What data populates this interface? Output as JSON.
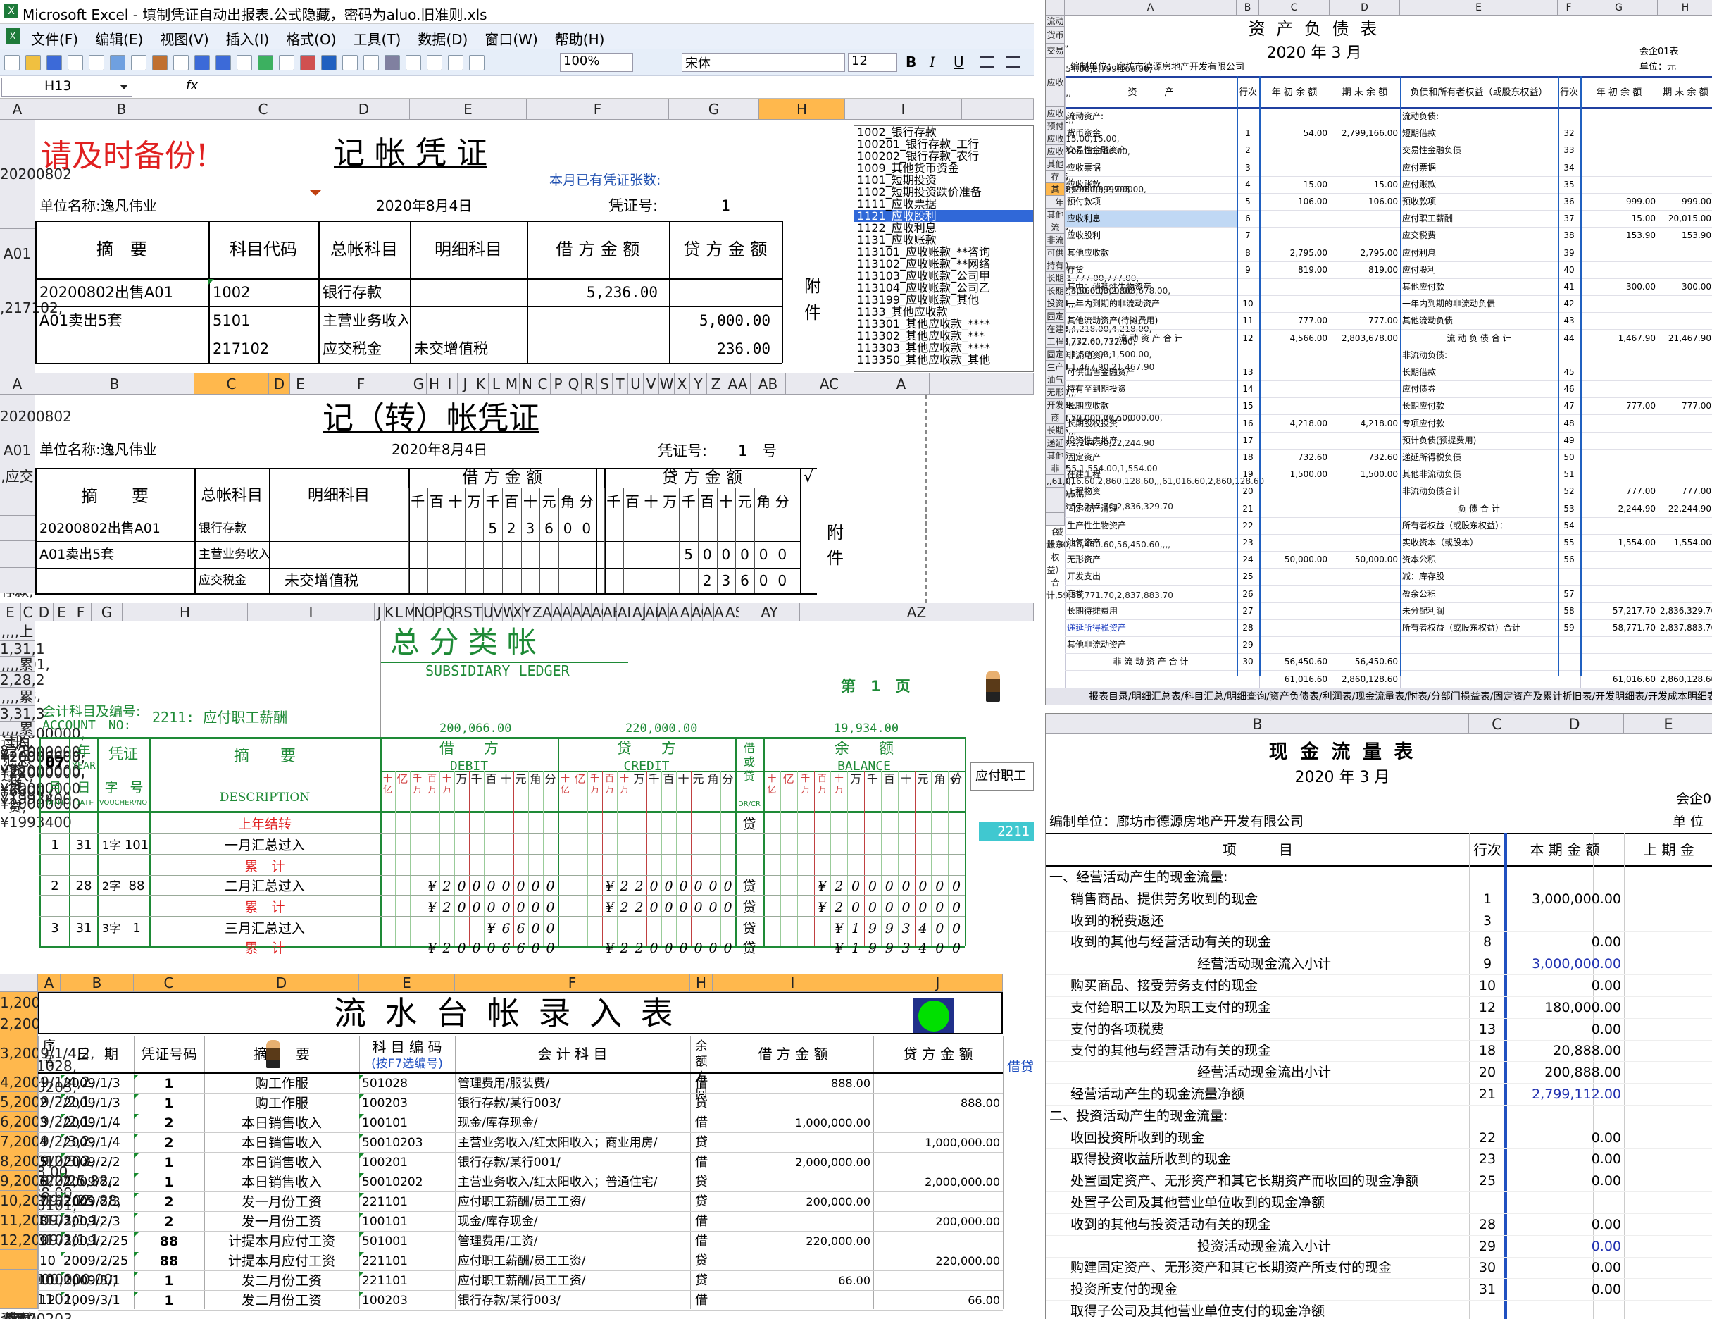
{
  "app": {
    "title": "Microsoft Excel - 填制凭证自动出报表.公式隐藏，密码为aluo.旧准则.xls",
    "name_box": "H13",
    "fx": "fx",
    "zoom": "100%",
    "font": "宋体",
    "size": "12"
  },
  "menu": [
    "文件(F)",
    "编辑(E)",
    "视图(V)",
    "插入(I)",
    "格式(O)",
    "工具(T)",
    "数据(D)",
    "窗口(W)",
    "帮助(H)"
  ],
  "fmt": {
    "bold": "B",
    "italic": "I",
    "under": "U"
  },
  "v1": {
    "cols": [
      "A",
      "B",
      "C",
      "D",
      "E",
      "F",
      "G",
      "H",
      "I"
    ],
    "rows": [
      [
        "20200802出售A01",
        "1002",
        "银行存款",
        "",
        "5,236.00",
        ""
      ],
      [
        "A01卖出5套",
        "5101",
        "主营业务收入",
        "",
        "",
        "5,000.00"
      ],
      [
        "",
        "217102",
        "应交税金",
        "未交增值税",
        "",
        "236.00"
      ]
    ],
    "reminder": "请及时备份!",
    "title": "记 帐 凭 证",
    "count_label": "本月已有凭证张数:",
    "unit": "单位名称:逸凡伟业",
    "date": "2020年8月4日",
    "no_label": "凭证号:",
    "no": "1",
    "headers": [
      "摘　要",
      "科目代码",
      "总帐科目",
      "明细科目",
      "借 方 金 额",
      "贷 方 金 额"
    ],
    "attach": [
      "附",
      "件"
    ],
    "list": [
      "1002_银行存款",
      "100201_银行存款_工行",
      "100202_银行存款_农行",
      "1009_其他货币资金",
      "1101_短期投资",
      "1102_短期投资跌价准备",
      "1111_应收票据",
      "1121_应收股利",
      "1122_应收利息",
      "1131_应收账款",
      "113101_应收账款_**咨询",
      "113102_应收账款_**网络",
      "113103_应收账款_公司甲",
      "113104_应收账款_公司乙",
      "113199_应收账款_其他",
      "1133_其他应收款",
      "113301_其他应收款_****",
      "113302_其他应收款_***",
      "113303_其他应收款_****",
      "113350_其他应收款_其他"
    ]
  },
  "v2": {
    "cols": [
      "A",
      "B",
      "C",
      "D",
      "E",
      "F",
      "G",
      "H",
      "I",
      "J",
      "K",
      "L",
      "M",
      "N",
      "C",
      "P",
      "Q",
      "R",
      "S",
      "T",
      "U",
      "V",
      "W",
      "X",
      "Y",
      "Z",
      "AA",
      "AB",
      "AC",
      "A"
    ],
    "rows": [
      [
        "20200802出售A01",
        "银行存款",
        ""
      ],
      [
        "A01卖出5套",
        "主营业务收入",
        ""
      ],
      [
        "",
        "应交税金",
        "未交增值税"
      ]
    ],
    "title": "记（转）帐凭证",
    "unit": "单位名称:逸凡伟业",
    "date": "2020年8月4日",
    "no_label": "凭证号:",
    "no": "1",
    "no_suffix": "号",
    "headers": [
      "摘　　要",
      "总帐科目",
      "明细科目",
      "借 方 金 额",
      "贷 方 金 额",
      "√"
    ],
    "units": [
      "千",
      "百",
      "十",
      "万",
      "千",
      "百",
      "十",
      "元",
      "角",
      "分"
    ],
    "debit": [
      "5",
      "2",
      "3",
      "6",
      "0",
      "0"
    ],
    "credit1": [
      "5",
      "0",
      "0",
      "0",
      "0",
      "0"
    ],
    "credit2": [
      "2",
      "3",
      "6",
      "0",
      "0"
    ],
    "attach": [
      "附",
      "件"
    ]
  },
  "v3": {
    "cols": [
      "E",
      "C",
      "D",
      "E",
      "F",
      "G",
      "H",
      "I",
      "J",
      "K",
      "L",
      "M",
      "N",
      "O",
      "P",
      "Q",
      "R",
      "S",
      "T",
      "U",
      "V",
      "W",
      "X",
      "Y",
      "Z",
      "AA",
      "AE",
      "AC",
      "AE",
      "AF",
      "AG",
      "AH",
      "AI",
      "AJ",
      "AK",
      "AL",
      "AM",
      "AN",
      "AC",
      "AE",
      "AR",
      "AS",
      "AY",
      "AZ"
    ],
    "rows": [
      [
        "",
        "",
        "",
        "",
        "上年结转",
        "",
        "",
        "贷",
        ""
      ],
      [
        "1",
        "31",
        "1字",
        "101",
        "一月汇总过入",
        "",
        "",
        "",
        ""
      ],
      [
        "",
        "",
        "",
        "",
        "累　计",
        "",
        "",
        "",
        ""
      ],
      [
        "2",
        "28",
        "2字",
        "88",
        "二月汇总过入",
        "¥20000000",
        "¥22000000",
        "贷",
        "¥20000000"
      ],
      [
        "",
        "",
        "",
        "",
        "累　计",
        "¥20000000",
        "¥22000000",
        "贷",
        "¥20000000"
      ],
      [
        "3",
        "31",
        "3字",
        "1",
        "三月汇总过入",
        "¥6600",
        "",
        "贷",
        "¥1993400"
      ],
      [
        "",
        "",
        "",
        "",
        "累　计",
        "¥20006600",
        "¥22000000",
        "贷",
        "¥1993400"
      ]
    ],
    "title": "总 分 类 帐",
    "subtitle": "SUBSIDIARY  LEDGER",
    "page": "第　1　页",
    "acct_label": "会计科目及编号:",
    "acct_en": "ACCOUNT　NO:",
    "acct": "2211: 应付职工薪酬",
    "totals": [
      "200,066.00",
      "220,000.00",
      "19,934.00"
    ],
    "h": {
      "year": "07",
      "year_lbl": "年",
      "year_en": "YEAR",
      "month": "月",
      "day": "日",
      "mth": "MTH",
      "date": "DATE",
      "voucher": "凭证",
      "zi": "字",
      "hao": "号",
      "voucher_en": "VOUCHER/NO",
      "desc": "摘　　要",
      "desc_en": "DESCRIPTION",
      "debit": "借　　方",
      "debit_en": "DEBIT",
      "credit": "贷　　方",
      "credit_en": "CREDIT",
      "dc": "借或贷",
      "dc_en": "DR/CR",
      "bal": "余　　额",
      "bal_en": "BALANCE",
      "check": "√",
      "side": "应付职工"
    },
    "units": [
      "十亿",
      "亿",
      "千万",
      "百万",
      "十万",
      "万",
      "千",
      "百",
      "十",
      "元",
      "角",
      "分"
    ],
    "code": "2211"
  },
  "v4": {
    "cols": [
      "A",
      "B",
      "C",
      "D",
      "E",
      "F",
      "H",
      "I",
      "J"
    ],
    "rows": [
      [
        "1",
        "2009/1/3",
        "1",
        "购工作服",
        "501028",
        "管理费用/服装费/",
        "借",
        "888.00",
        ""
      ],
      [
        "2",
        "2009/1/3",
        "1",
        "购工作服",
        "100203",
        "银行存款/某行003/",
        "贷",
        "",
        "888.00"
      ],
      [
        "3",
        "2009/1/4",
        "2",
        "本日销售收入",
        "100101",
        "现金/库存现金/",
        "借",
        "1,000,000.00",
        ""
      ],
      [
        "4",
        "2009/1/4",
        "2",
        "本日销售收入",
        "50010203",
        "主营业务收入/红太阳收入；商业用房/",
        "贷",
        "",
        "1,000,000.00"
      ],
      [
        "5",
        "2009/2/2",
        "1",
        "本日销售收入",
        "100201",
        "银行存款/某行001/",
        "借",
        "2,000,000.00",
        ""
      ],
      [
        "6",
        "2009/2/2",
        "1",
        "本日销售收入",
        "50010202",
        "主营业务收入/红太阳收入；普通住宅/",
        "贷",
        "",
        "2,000,000.00"
      ],
      [
        "7",
        "2009/2/3",
        "2",
        "发一月份工资",
        "221101",
        "应付职工薪酬/员工工资/",
        "贷",
        "200,000.00",
        ""
      ],
      [
        "8",
        "2009/2/3",
        "2",
        "发一月份工资",
        "100101",
        "现金/库存现金/",
        "借",
        "",
        "200,000.00"
      ],
      [
        "9",
        "2009/2/25",
        "88",
        "计提本月应付工资",
        "501001",
        "管理费用/工资/",
        "借",
        "220,000.00",
        ""
      ],
      [
        "10",
        "2009/2/25",
        "88",
        "计提本月应付工资",
        "221101",
        "应付职工薪酬/员工工资/",
        "贷",
        "",
        "220,000.00"
      ],
      [
        "11",
        "2009/3/1",
        "1",
        "发二月份工资",
        "221101",
        "应付职工薪酬/员工工资/",
        "贷",
        "66.00",
        ""
      ],
      [
        "12",
        "2009/3/1",
        "1",
        "发二月份工资",
        "100203",
        "银行存款/某行003/",
        "借",
        "",
        "66.00"
      ]
    ],
    "title": "流 水 台 帐 录 入 表",
    "status_color": "#00e000",
    "headers": [
      "序号",
      "日　期",
      "凭证号码",
      "摘　　要",
      "科 目 编 码",
      "(按F7选编号)",
      "会 计 科 目",
      "余额方向",
      "借 方 金 额",
      "贷 方 金 额",
      "借贷"
    ]
  },
  "v5": {
    "cols": [
      "A",
      "B",
      "C",
      "D",
      "E",
      "F",
      "G",
      "H"
    ],
    "rows": [
      [
        "流动资产:",
        "",
        "",
        "",
        "流动负债:",
        "",
        "",
        ""
      ],
      [
        "货币资金",
        "1",
        "54.00",
        "2,799,166.00",
        "短期借款",
        "32",
        "",
        ""
      ],
      [
        "交易性金融资产",
        "2",
        "",
        "",
        "交易性金融负债",
        "33",
        "",
        ""
      ],
      [
        "应收票据",
        "3",
        "",
        "",
        "应付票据",
        "34",
        "",
        ""
      ],
      [
        "应收账款",
        "4",
        "15.00",
        "15.00",
        "应付账款",
        "35",
        "",
        ""
      ],
      [
        "预付款项",
        "5",
        "106.00",
        "106.00",
        "预收款项",
        "36",
        "999.00",
        "999.00"
      ],
      [
        "应收利息",
        "6",
        "",
        "",
        "应付职工薪酬",
        "37",
        "15.00",
        "20,015.00"
      ],
      [
        "应收股利",
        "7",
        "",
        "",
        "应交税费",
        "38",
        "153.90",
        "153.90"
      ],
      [
        "其他应收款",
        "8",
        "2,795.00",
        "2,795.00",
        "应付利息",
        "39",
        "",
        ""
      ],
      [
        "存货",
        "9",
        "819.00",
        "819.00",
        "应付股利",
        "40",
        "",
        ""
      ],
      [
        "其中：消耗性生物资产",
        "",
        "",
        "",
        "其他应付款",
        "41",
        "300.00",
        "300.00"
      ],
      [
        "一年内到期的非流动资产",
        "10",
        "",
        "",
        "一年内到期的非流动负债",
        "42",
        "",
        ""
      ],
      [
        "其他流动资产(待摊费用)",
        "11",
        "777.00",
        "777.00",
        "其他流动负债",
        "43",
        "",
        ""
      ],
      [
        "流 动 资 产 合 计",
        "12",
        "4,566.00",
        "2,803,678.00",
        "流 动 负 债 合 计",
        "44",
        "1,467.90",
        "21,467.90"
      ],
      [
        "非流动资产:",
        "",
        "",
        "",
        "非流动负债:",
        "",
        "",
        ""
      ],
      [
        "可供出售金融资产",
        "13",
        "",
        "",
        "长期借款",
        "45",
        "",
        ""
      ],
      [
        "持有至到期投资",
        "14",
        "",
        "",
        "应付债券",
        "46",
        "",
        ""
      ],
      [
        "长期应收款",
        "15",
        "",
        "",
        "长期应付款",
        "47",
        "777.00",
        "777.00"
      ],
      [
        "长期股权投资",
        "16",
        "4,218.00",
        "4,218.00",
        "专项应付款",
        "48",
        "",
        ""
      ],
      [
        "投资性房地产",
        "17",
        "",
        "",
        "预计负债(预提费用)",
        "49",
        "",
        ""
      ],
      [
        "固定资产",
        "18",
        "732.60",
        "732.60",
        "递延所得税负债",
        "50",
        "",
        ""
      ],
      [
        "在建工程",
        "19",
        "1,500.00",
        "1,500.00",
        "其他非流动负债",
        "51",
        "",
        ""
      ],
      [
        "工程物资",
        "20",
        "",
        "",
        "非流动负债合计",
        "52",
        "777.00",
        "777.00"
      ],
      [
        "固定资产清理",
        "21",
        "",
        "",
        "负 债 合 计",
        "53",
        "2,244.90",
        "22,244.90"
      ],
      [
        "生产性生物资产",
        "22",
        "",
        "",
        "所有者权益（或股东权益）：",
        "54",
        "",
        ""
      ],
      [
        "油气资产",
        "23",
        "",
        "",
        "实收资本（或股本）",
        "55",
        "1,554.00",
        "1,554.00"
      ],
      [
        "无形资产",
        "24",
        "50,000.00",
        "50,000.00",
        "资本公积",
        "56",
        "",
        ""
      ],
      [
        "开发支出",
        "25",
        "",
        "",
        "减：库存股",
        "",
        "",
        ""
      ],
      [
        "商誉",
        "26",
        "",
        "",
        "盈余公积",
        "57",
        "",
        ""
      ],
      [
        "长期待摊费用",
        "27",
        "",
        "",
        "未分配利润",
        "58",
        "57,217.70",
        "2,836,329.70"
      ],
      [
        "递延所得税资产",
        "28",
        "",
        "",
        "所有者权益（或股东权益）合计",
        "59",
        "58,771.70",
        "2,837,883.70"
      ],
      [
        "其他非流动资产",
        "29",
        "",
        "",
        "",
        "",
        "",
        ""
      ],
      [
        "非 流 动 资 产 合 计",
        "30",
        "56,450.60",
        "56,450.60",
        "",
        "",
        "",
        ""
      ],
      [
        "",
        "",
        "61,016.60",
        "2,860,128.60",
        "",
        "",
        "61,016.60",
        "2,860,128.60"
      ]
    ],
    "title": "资 产 负 债 表",
    "date": "2020 年 3 月",
    "company": "编制单位：廊坊市德源房地产开发有限公司",
    "form": "会企01表",
    "unit": "单位：元",
    "headers": [
      "资　　　产",
      "行次",
      "年 初 余 额",
      "期 末 余 额",
      "负债和所有者权益（或股东权益）",
      "行次",
      "年 初 余 额",
      "期 末 余 额"
    ],
    "tabs": "报表目录/明细汇总表/科目汇总/明细查询/资产负债表/利润表/现金流量表/附表/分部门损益表/固定资产及累计折旧表/开发明细表/开发成本明细表"
  },
  "v6": {
    "cols": [
      "B",
      "C",
      "D",
      "E"
    ],
    "title": "现 金 流 量 表",
    "date": "2020 年 3 月",
    "form": "会企0",
    "company": "编制单位：廊坊市德源房地产开发有限公司",
    "unit": "单 位",
    "headers": [
      "项　　　目",
      "行次",
      "本 期 金 额",
      "上 期 金"
    ],
    "rows": [
      [
        "一、经营活动产生的现金流量:",
        "",
        ""
      ],
      [
        "销售商品、提供劳务收到的现金",
        "1",
        "3,000,000.00"
      ],
      [
        "收到的税费返还",
        "3",
        ""
      ],
      [
        "收到的其他与经营活动有关的现金",
        "8",
        "0.00"
      ],
      [
        "经营活动现金流入小计",
        "9",
        "3,000,000.00"
      ],
      [
        "购买商品、接受劳务支付的现金",
        "10",
        "0.00"
      ],
      [
        "支付给职工以及为职工支付的现金",
        "12",
        "180,000.00"
      ],
      [
        "支付的各项税费",
        "13",
        "0.00"
      ],
      [
        "支付的其他与经营活动有关的现金",
        "18",
        "20,888.00"
      ],
      [
        "经营活动现金流出小计",
        "20",
        "200,888.00"
      ],
      [
        "经营活动产生的现金流量净额",
        "21",
        "2,799,112.00"
      ],
      [
        "二、投资活动产生的现金流量:",
        "",
        ""
      ],
      [
        "收回投资所收到的现金",
        "22",
        "0.00"
      ],
      [
        "取得投资收益所收到的现金",
        "23",
        "0.00"
      ],
      [
        "处置固定资产、无形资产和其它长期资产而收回的现金净额",
        "25",
        "0.00"
      ],
      [
        "处置子公司及其他营业单位收到的现金净额",
        "",
        ""
      ],
      [
        "收到的其他与投资活动有关的现金",
        "28",
        "0.00"
      ],
      [
        "投资活动现金流入小计",
        "29",
        "0.00"
      ],
      [
        "购建固定资产、无形资产和其它长期资产所支付的现金",
        "30",
        "0.00"
      ],
      [
        "投资所支付的现金",
        "31",
        "0.00"
      ],
      [
        "取得子公司及其他营业单位支付的现金净额",
        "",
        ""
      ]
    ]
  }
}
